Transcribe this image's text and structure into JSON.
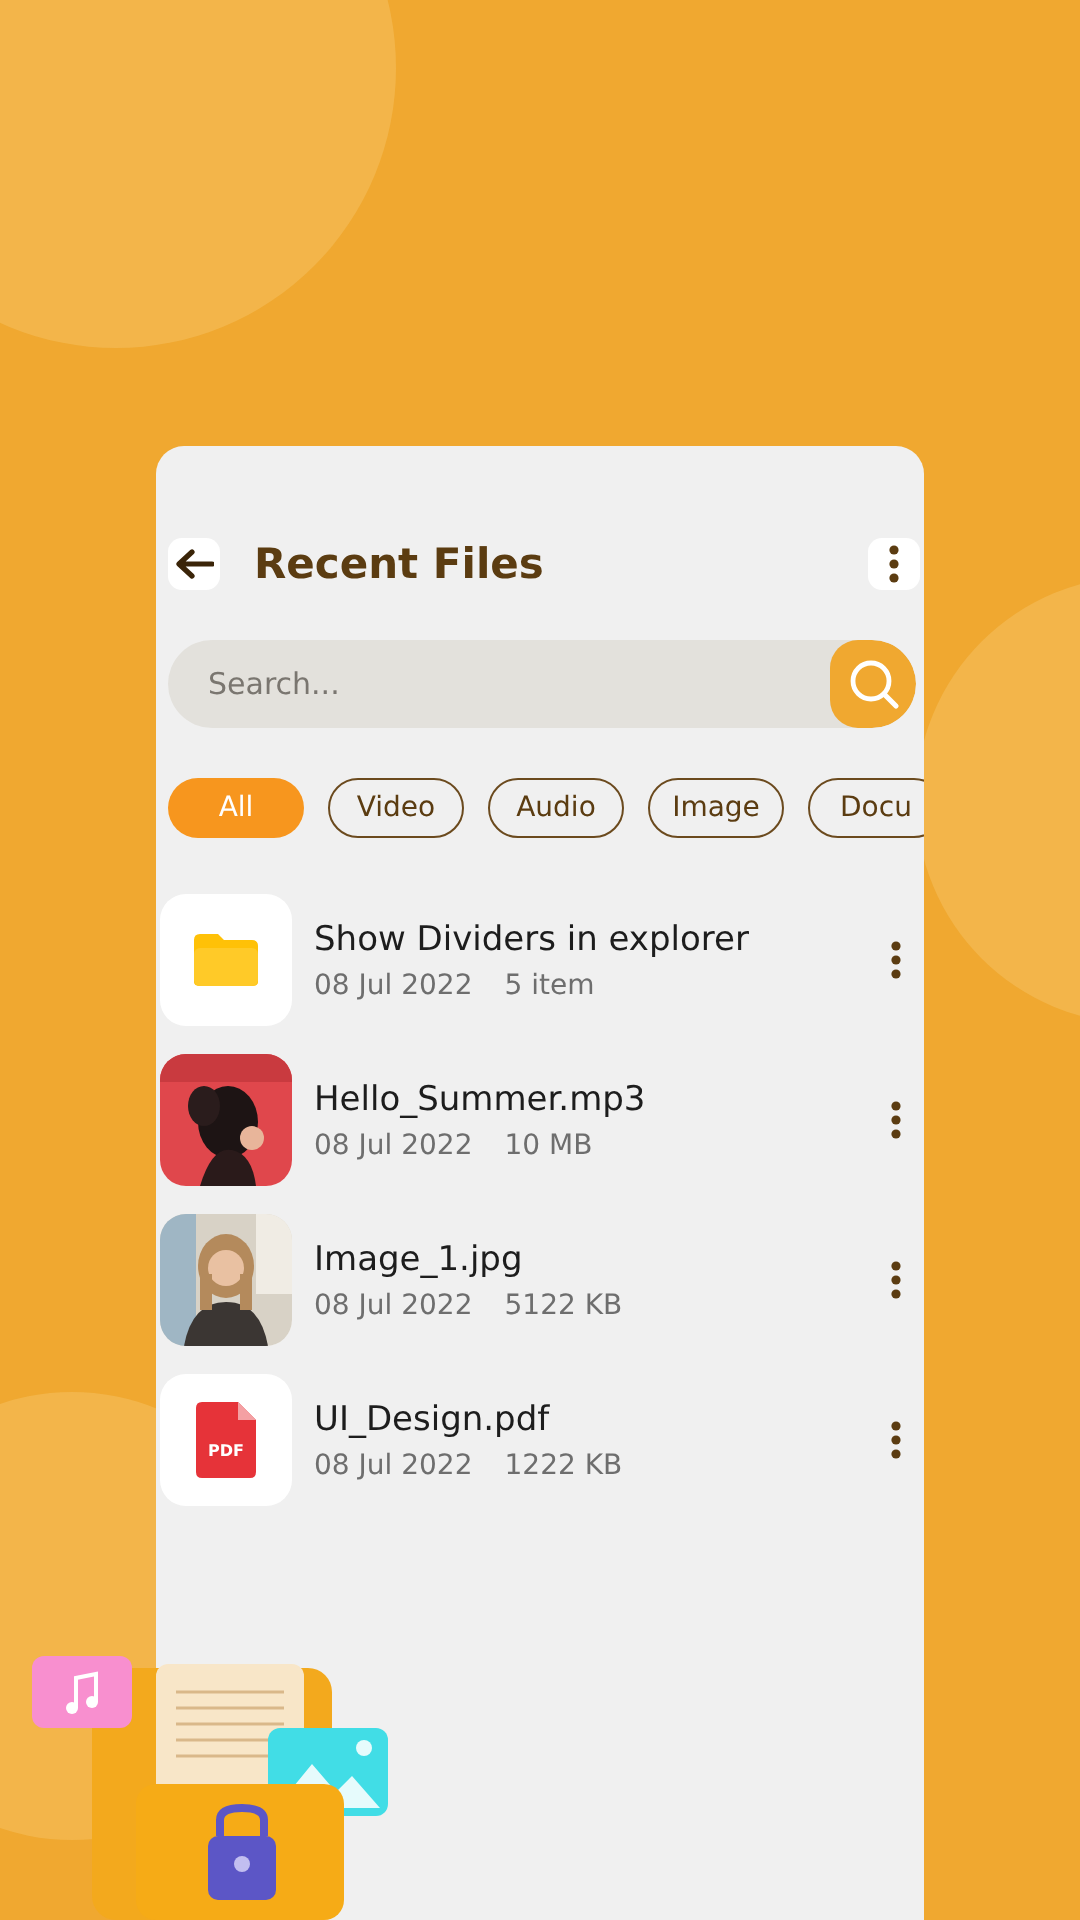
{
  "header": {
    "title": "Recent Files"
  },
  "search": {
    "placeholder": "Search..."
  },
  "filters": [
    {
      "label": "All",
      "selected": true
    },
    {
      "label": "Video",
      "selected": false
    },
    {
      "label": "Audio",
      "selected": false
    },
    {
      "label": "Image",
      "selected": false
    },
    {
      "label": "Docu",
      "selected": false
    }
  ],
  "files": [
    {
      "kind": "folder",
      "name": "Show Dividers in explorer",
      "date": "08 Jul 2022",
      "size": "5 item"
    },
    {
      "kind": "album",
      "name": "Hello_Summer.mp3",
      "date": "08 Jul 2022",
      "size": "10 MB"
    },
    {
      "name": "Image_1.jpg",
      "date": "08 Jul 2022",
      "size": "5122 KB"
    },
    {
      "kind": "pdf",
      "name": "UI_Design.pdf",
      "date": "08 Jul 2022",
      "size": "1222 KB",
      "badge": "PDF"
    }
  ]
}
